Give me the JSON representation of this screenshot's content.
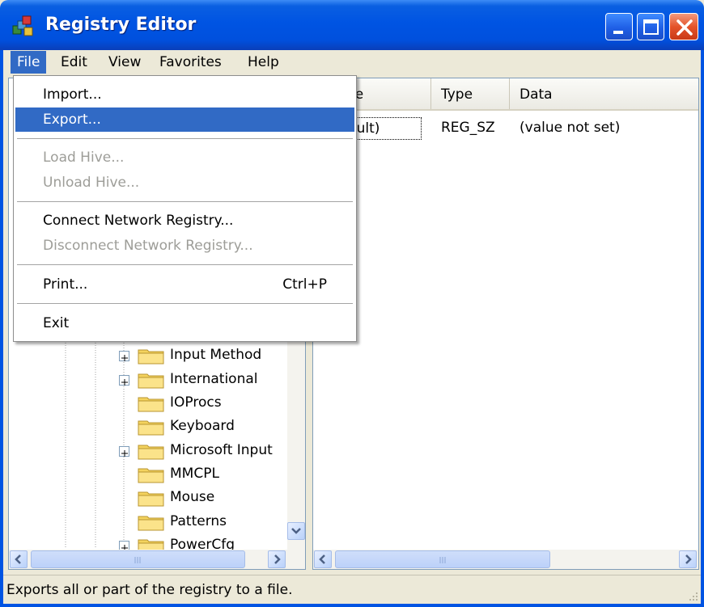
{
  "window": {
    "title": "Registry Editor",
    "colors": {
      "titlebar": "#0054e3",
      "menu_highlight": "#316ac5",
      "close_button": "#e4532a"
    }
  },
  "menubar": {
    "items": [
      {
        "label": "File",
        "active": true
      },
      {
        "label": "Edit"
      },
      {
        "label": "View"
      },
      {
        "label": "Favorites"
      },
      {
        "label": "Help"
      }
    ]
  },
  "file_menu": {
    "items": [
      {
        "label": "Import...",
        "enabled": true
      },
      {
        "label": "Export...",
        "enabled": true,
        "selected": true
      },
      {
        "label": "Load Hive...",
        "enabled": false
      },
      {
        "label": "Unload Hive...",
        "enabled": false
      },
      {
        "label": "Connect Network Registry...",
        "enabled": true
      },
      {
        "label": "Disconnect Network Registry...",
        "enabled": false
      },
      {
        "label": "Print...",
        "shortcut": "Ctrl+P",
        "enabled": true
      },
      {
        "label": "Exit",
        "enabled": true
      }
    ]
  },
  "tree": {
    "items": [
      {
        "label": "Input Method",
        "expandable": true
      },
      {
        "label": "International",
        "expandable": true
      },
      {
        "label": "IOProcs",
        "expandable": false
      },
      {
        "label": "Keyboard",
        "expandable": false
      },
      {
        "label": "Microsoft Input",
        "expandable": true
      },
      {
        "label": "MMCPL",
        "expandable": false
      },
      {
        "label": "Mouse",
        "expandable": false
      },
      {
        "label": "Patterns",
        "expandable": false
      },
      {
        "label": "PowerCfg",
        "expandable": true
      }
    ]
  },
  "list": {
    "columns": [
      "Name",
      "Type",
      "Data"
    ],
    "rows": [
      {
        "name": "(Default)",
        "type": "REG_SZ",
        "data": "(value not set)"
      }
    ]
  },
  "statusbar": {
    "text": "Exports all or part of the registry to a file."
  }
}
